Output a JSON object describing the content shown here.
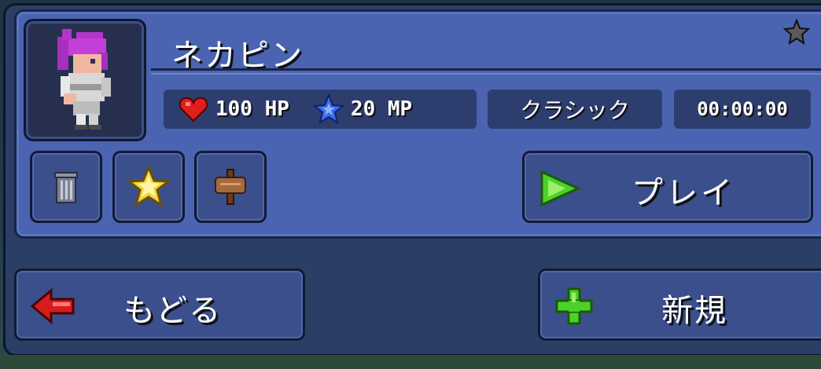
{
  "character": {
    "name": "ネカピン",
    "hp": "100 HP",
    "mp": "20 MP",
    "difficulty": "クラシック",
    "playtime": "00:00:00",
    "favorite": false
  },
  "actions": {
    "delete_icon": "trash-icon",
    "favorite_icon": "gold-star-icon",
    "rename_icon": "wooden-sign-icon",
    "play_label": "プレイ"
  },
  "footer": {
    "back_label": "もどる",
    "new_label": "新規"
  },
  "colors": {
    "card": "#4a64b2",
    "panel": "#2b3f66",
    "button": "#3b4f8c",
    "heart": "#e01e1e",
    "mana_star": "#3a6ee8",
    "play_arrow": "#4cd12a",
    "back_arrow": "#d81c1c",
    "plus": "#4cd12a"
  }
}
